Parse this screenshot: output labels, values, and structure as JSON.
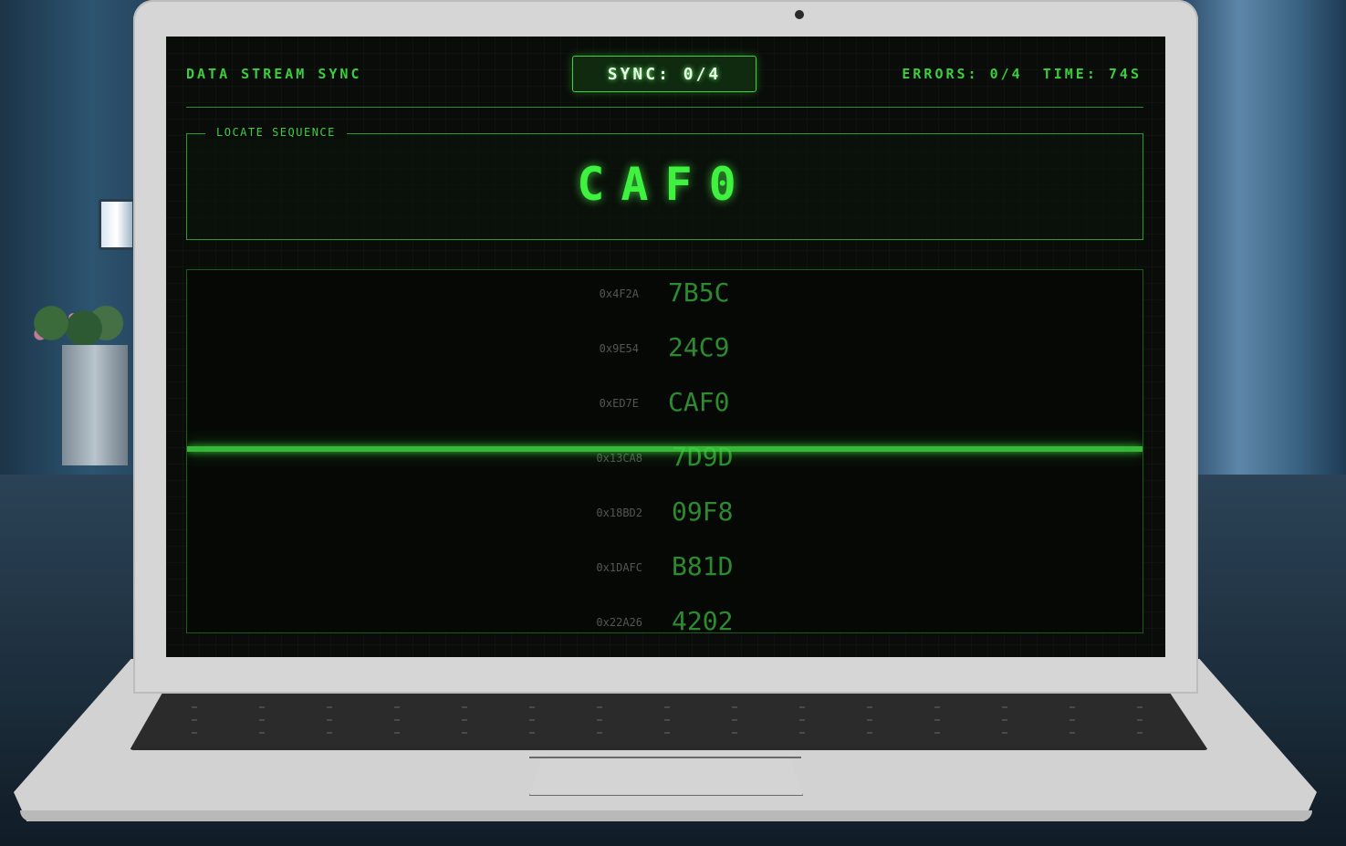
{
  "header": {
    "title": "DATA STREAM SYNC",
    "sync": "SYNC: 0/4",
    "errors": "ERRORS: 0/4",
    "time": "TIME: 74S"
  },
  "target": {
    "label": "LOCATE SEQUENCE",
    "sequence": "CAF0"
  },
  "stream": [
    {
      "addr": "0x4F2A",
      "code": "7B5C"
    },
    {
      "addr": "0x9E54",
      "code": "24C9"
    },
    {
      "addr": "0xED7E",
      "code": "CAF0"
    },
    {
      "addr": "0x13CA8",
      "code": "7D9D"
    },
    {
      "addr": "0x18BD2",
      "code": "09F8"
    },
    {
      "addr": "0x1DAFC",
      "code": "B81D"
    },
    {
      "addr": "0x22A26",
      "code": "4202"
    }
  ],
  "colors": {
    "accent": "#3fd13f",
    "text_dim": "#2e8a2e",
    "background": "#0a0c0a"
  }
}
